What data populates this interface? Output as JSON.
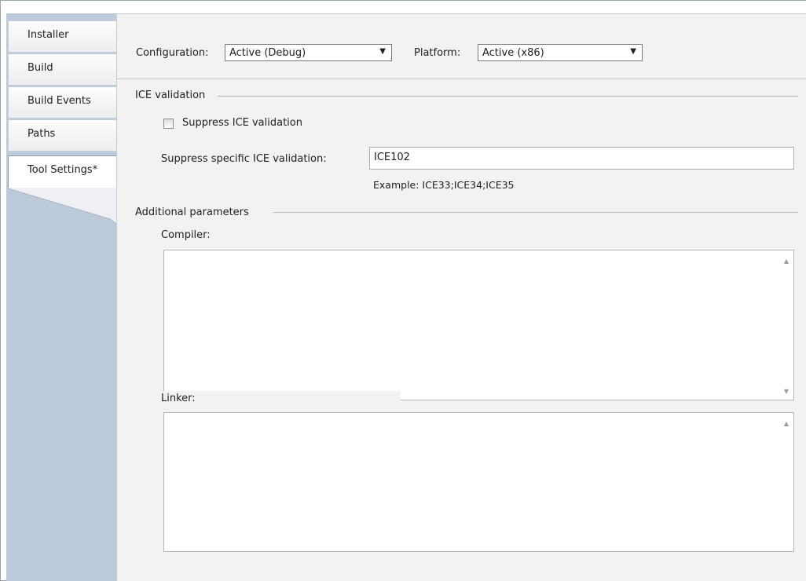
{
  "tabs": [
    {
      "label": "Installer"
    },
    {
      "label": "Build"
    },
    {
      "label": "Build Events"
    },
    {
      "label": "Paths"
    },
    {
      "label": "Tool Settings*"
    }
  ],
  "config": {
    "configuration_label": "Configuration:",
    "configuration_value": "Active (Debug)",
    "platform_label": "Platform:",
    "platform_value": "Active (x86)"
  },
  "ice": {
    "section_title": "ICE validation",
    "suppress_label": "Suppress ICE validation",
    "suppress_checked": false,
    "specific_label": "Suppress specific ICE validation:",
    "specific_value": "ICE102",
    "example": "Example: ICE33;ICE34;ICE35"
  },
  "params": {
    "section_title": "Additional parameters",
    "compiler_label": "Compiler:",
    "linker_label": "Linker:"
  },
  "icons": {
    "dropdown": "chevron-down-icon",
    "scroll_up": "scroll-up-arrow-icon",
    "scroll_down": "scroll-down-arrow-icon"
  }
}
